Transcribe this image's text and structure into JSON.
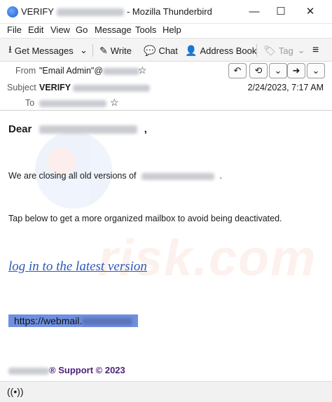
{
  "window": {
    "title_prefix": "VERIFY",
    "title_suffix": "- Mozilla Thunderbird",
    "minimize": "—",
    "maximize": "☐",
    "close": "✕"
  },
  "menu": [
    "File",
    "Edit",
    "View",
    "Go",
    "Message",
    "Tools",
    "Help"
  ],
  "toolbar": {
    "get_messages": "Get Messages",
    "write": "Write",
    "chat": "Chat",
    "address_book": "Address Book",
    "tag": "Tag"
  },
  "header": {
    "from_label": "From",
    "from_value": "\"Email Admin\"@",
    "subject_label": "Subject",
    "subject_value": "VERIFY",
    "to_label": "To",
    "date": "2/24/2023, 7:17 AM"
  },
  "body": {
    "greeting": "Dear",
    "greeting_end": ",",
    "para1_start": "We are closing all old versions of",
    "para1_end": ".",
    "para2": "Tap below to get a more organized mailbox to avoid being deactivated.",
    "link_text": "log in to the latest version",
    "url_text": "https://webmail.",
    "footer_reg": "®",
    "footer_text": "Support  ©  2023"
  },
  "watermark": "risk.com",
  "colors": {
    "link": "#2b59b8",
    "url_highlight": "#6f8fe0",
    "footer": "#4b1f7a"
  },
  "icons": {
    "status": "wifi-broadcast-icon"
  }
}
